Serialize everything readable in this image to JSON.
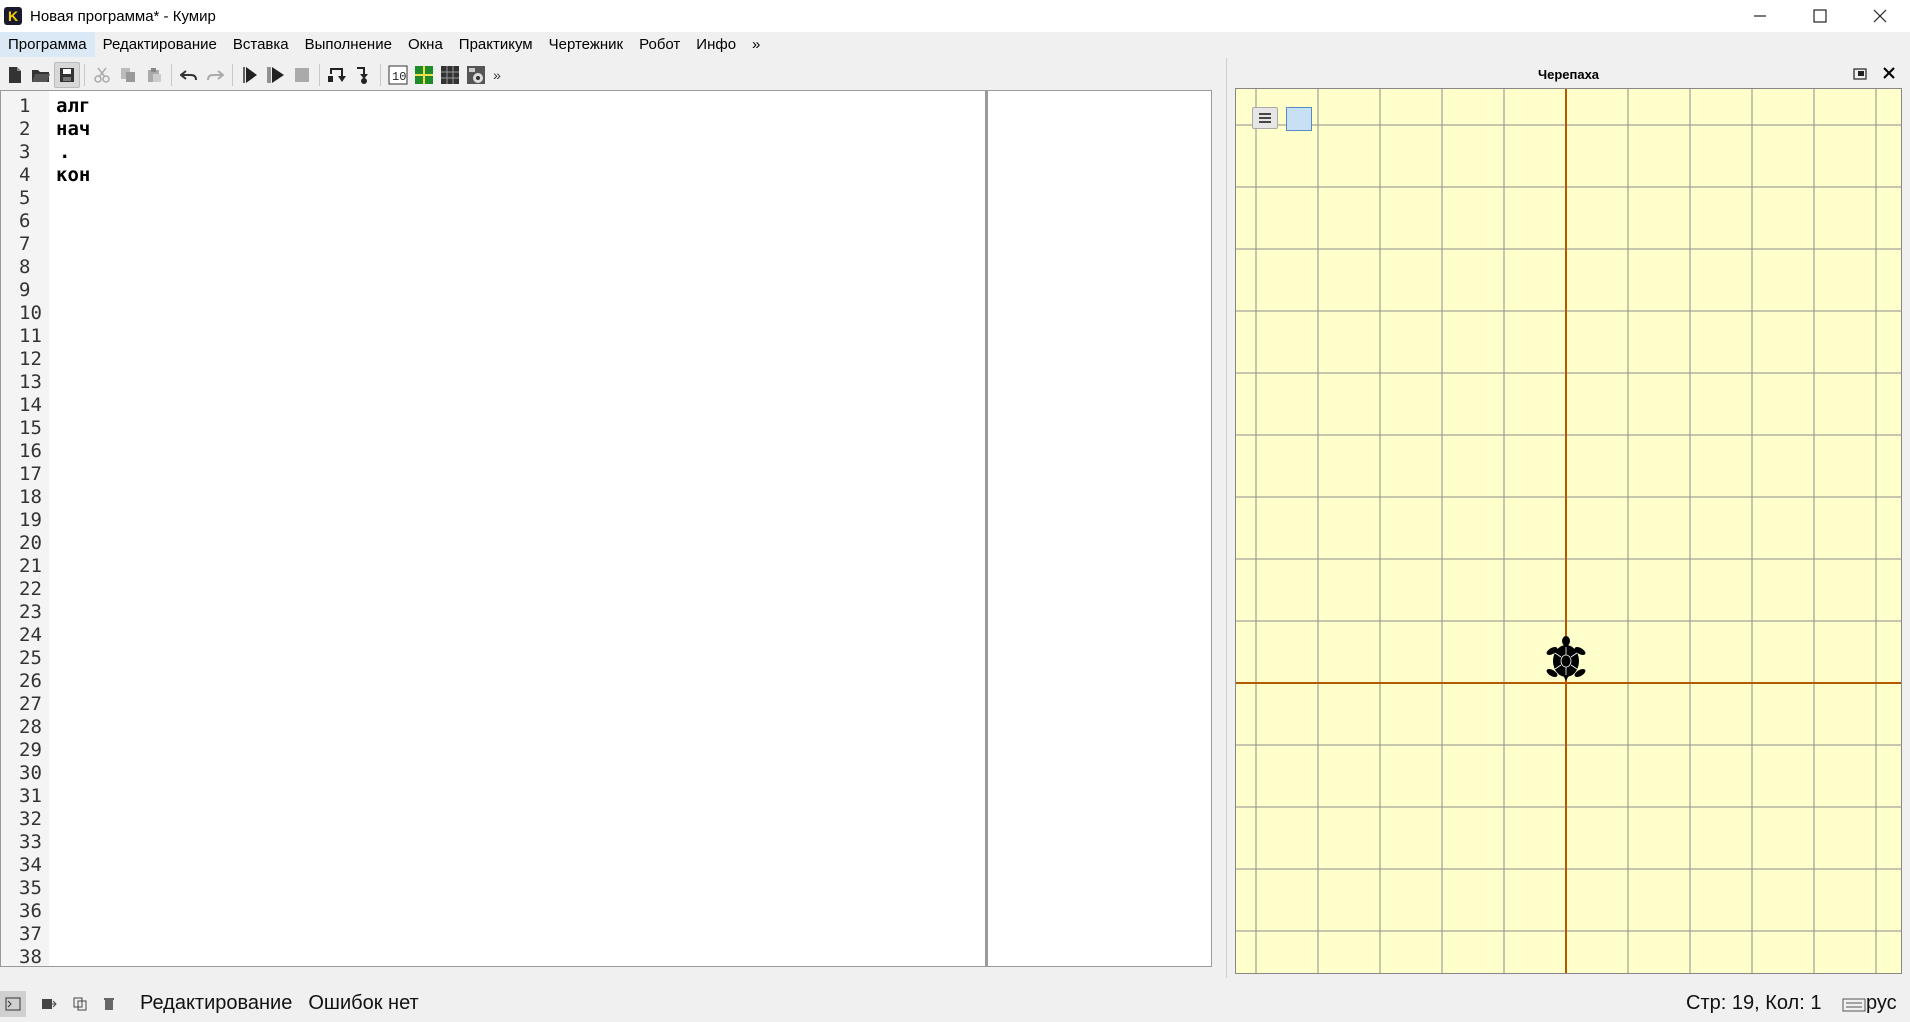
{
  "window": {
    "title": "Новая программа* - Кумир",
    "app_icon_letter": "K",
    "minimize": "—",
    "maximize": "☐",
    "close": "✕"
  },
  "menu": [
    {
      "label": "Программа",
      "active": true
    },
    {
      "label": "Редактирование"
    },
    {
      "label": "Вставка"
    },
    {
      "label": "Выполнение"
    },
    {
      "label": "Окна"
    },
    {
      "label": "Практикум"
    },
    {
      "label": "Чертежник"
    },
    {
      "label": "Робот"
    },
    {
      "label": "Инфо"
    },
    {
      "label": "»"
    }
  ],
  "toolbar": {
    "overflow": "»",
    "buttons": [
      {
        "name": "new-file-icon"
      },
      {
        "name": "open-folder-icon"
      },
      {
        "name": "save-icon"
      },
      {
        "name": "cut-icon"
      },
      {
        "name": "copy-icon"
      },
      {
        "name": "paste-icon"
      },
      {
        "name": "undo-icon"
      },
      {
        "name": "redo-icon"
      },
      {
        "name": "run-icon"
      },
      {
        "name": "run-steps-icon"
      },
      {
        "name": "stop-icon"
      },
      {
        "name": "step-over-icon"
      },
      {
        "name": "step-into-icon"
      },
      {
        "name": "numbers-icon"
      },
      {
        "name": "grid-green-icon"
      },
      {
        "name": "grid-dark-icon"
      },
      {
        "name": "image-icon"
      }
    ]
  },
  "editor": {
    "lines": [
      "алг",
      "нач",
      ".",
      "кон"
    ],
    "line_count": 38
  },
  "turtle": {
    "title": "Черепаха",
    "canvas_color": "#ffffcc",
    "grid_color": "#8c8c8c",
    "axis_color": "#b35900"
  },
  "status": {
    "mode": "Редактирование",
    "errors": "Ошибок нет",
    "position": "Стр: 19, Кол: 1",
    "lang": "рус"
  }
}
